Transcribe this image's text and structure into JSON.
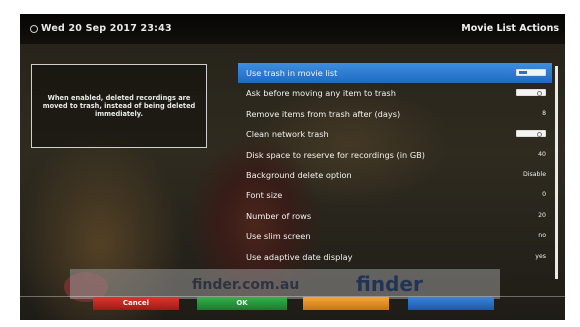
{
  "header": {
    "datetime": "Wed 20 Sep 2017  23:43",
    "title": "Movie List Actions"
  },
  "help": {
    "text": "When enabled, deleted recordings are moved to trash, instead of being deleted immediately."
  },
  "menu": {
    "items": [
      {
        "label": "Use trash in movie list",
        "value": "on",
        "kind": "toggle",
        "selected": true
      },
      {
        "label": "Ask before moving any item to trash",
        "value": "off",
        "kind": "toggle"
      },
      {
        "label": "Remove items from trash after (days)",
        "value": "8",
        "kind": "text"
      },
      {
        "label": "Clean network trash",
        "value": "off",
        "kind": "toggle"
      },
      {
        "label": "Disk space to reserve for recordings (in GB)",
        "value": "40",
        "kind": "text"
      },
      {
        "label": "Background delete option",
        "value": "Disable",
        "kind": "text"
      },
      {
        "label": "Font size",
        "value": "0",
        "kind": "text"
      },
      {
        "label": "Number of rows",
        "value": "20",
        "kind": "text"
      },
      {
        "label": "Use slim screen",
        "value": "no",
        "kind": "text"
      },
      {
        "label": "Use adaptive date display",
        "value": "yes",
        "kind": "text"
      }
    ]
  },
  "buttons": {
    "red": "Cancel",
    "green": "OK",
    "yellow": "",
    "blue": ""
  },
  "background": {
    "banner_text": "finder.com.au",
    "banner_logo": "finder"
  },
  "colors": {
    "selected_row": "#2b78d4",
    "red": "#c8261f",
    "green": "#28993b",
    "yellow": "#e38e22",
    "blue": "#2b6fc2"
  }
}
